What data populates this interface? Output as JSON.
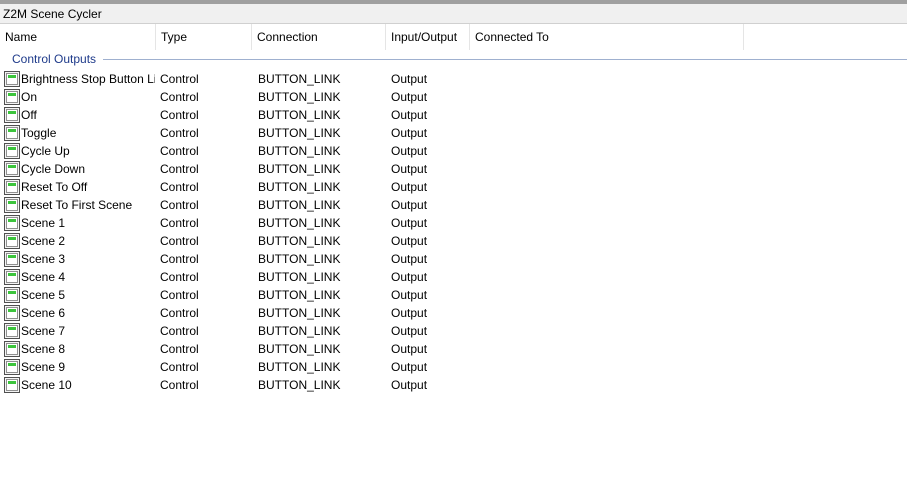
{
  "window": {
    "title": "Z2M Scene Cycler"
  },
  "columns": {
    "name": "Name",
    "type": "Type",
    "connection": "Connection",
    "io": "Input/Output",
    "connected_to": "Connected To"
  },
  "group": {
    "label": "Control Outputs"
  },
  "rows": [
    {
      "name": "Brightness Stop Button Link",
      "type": "Control",
      "connection": "BUTTON_LINK",
      "io": "Output",
      "icon": "button-link-icon"
    },
    {
      "name": "On",
      "type": "Control",
      "connection": "BUTTON_LINK",
      "io": "Output",
      "icon": "button-link-icon"
    },
    {
      "name": "Off",
      "type": "Control",
      "connection": "BUTTON_LINK",
      "io": "Output",
      "icon": "button-link-icon"
    },
    {
      "name": "Toggle",
      "type": "Control",
      "connection": "BUTTON_LINK",
      "io": "Output",
      "icon": "button-link-icon"
    },
    {
      "name": "Cycle Up",
      "type": "Control",
      "connection": "BUTTON_LINK",
      "io": "Output",
      "icon": "button-link-icon"
    },
    {
      "name": "Cycle Down",
      "type": "Control",
      "connection": "BUTTON_LINK",
      "io": "Output",
      "icon": "button-link-icon"
    },
    {
      "name": "Reset To Off",
      "type": "Control",
      "connection": "BUTTON_LINK",
      "io": "Output",
      "icon": "button-link-icon"
    },
    {
      "name": "Reset To First Scene",
      "type": "Control",
      "connection": "BUTTON_LINK",
      "io": "Output",
      "icon": "button-link-icon"
    },
    {
      "name": "Scene 1",
      "type": "Control",
      "connection": "BUTTON_LINK",
      "io": "Output",
      "icon": "button-link-icon"
    },
    {
      "name": "Scene 2",
      "type": "Control",
      "connection": "BUTTON_LINK",
      "io": "Output",
      "icon": "button-link-icon"
    },
    {
      "name": "Scene 3",
      "type": "Control",
      "connection": "BUTTON_LINK",
      "io": "Output",
      "icon": "button-link-icon"
    },
    {
      "name": "Scene 4",
      "type": "Control",
      "connection": "BUTTON_LINK",
      "io": "Output",
      "icon": "button-link-icon"
    },
    {
      "name": "Scene 5",
      "type": "Control",
      "connection": "BUTTON_LINK",
      "io": "Output",
      "icon": "button-link-icon"
    },
    {
      "name": "Scene 6",
      "type": "Control",
      "connection": "BUTTON_LINK",
      "io": "Output",
      "icon": "button-link-icon"
    },
    {
      "name": "Scene 7",
      "type": "Control",
      "connection": "BUTTON_LINK",
      "io": "Output",
      "icon": "button-link-icon"
    },
    {
      "name": "Scene 8",
      "type": "Control",
      "connection": "BUTTON_LINK",
      "io": "Output",
      "icon": "button-link-icon"
    },
    {
      "name": "Scene 9",
      "type": "Control",
      "connection": "BUTTON_LINK",
      "io": "Output",
      "icon": "button-link-icon"
    },
    {
      "name": "Scene 10",
      "type": "Control",
      "connection": "BUTTON_LINK",
      "io": "Output",
      "icon": "button-link-icon"
    }
  ],
  "colors": {
    "group_label": "#1e3a8a",
    "icon_green": "#3cc43c",
    "title_bar": "#f0f0f0"
  }
}
